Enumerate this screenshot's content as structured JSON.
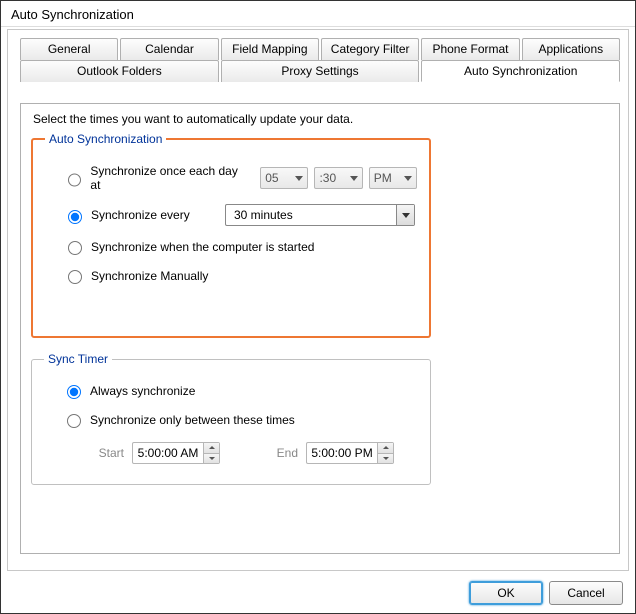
{
  "window": {
    "title": "Auto Synchronization"
  },
  "tabs": {
    "row1": [
      {
        "label": "General"
      },
      {
        "label": "Calendar"
      },
      {
        "label": "Field Mapping"
      },
      {
        "label": "Category Filter"
      },
      {
        "label": "Phone Format"
      },
      {
        "label": "Applications"
      }
    ],
    "row2": [
      {
        "label": "Outlook Folders"
      },
      {
        "label": "Proxy Settings"
      },
      {
        "label": "Auto Synchronization"
      }
    ]
  },
  "instruction": "Select the times you want to automatically update your data.",
  "autoSync": {
    "legend": "Auto Synchronization",
    "onceLabel": "Synchronize once each day at",
    "hour": "05",
    "minute": ":30",
    "ampm": "PM",
    "everyLabel": "Synchronize every",
    "everyValue": "30 minutes",
    "startupLabel": "Synchronize when the computer is started",
    "manualLabel": "Synchronize Manually",
    "selected": "every"
  },
  "syncTimer": {
    "legend": "Sync Timer",
    "alwaysLabel": "Always synchronize",
    "betweenLabel": "Synchronize only between these times",
    "startLabel": "Start",
    "startValue": "5:00:00 AM",
    "endLabel": "End",
    "endValue": "5:00:00 PM",
    "selected": "always"
  },
  "buttons": {
    "ok": "OK",
    "cancel": "Cancel"
  }
}
